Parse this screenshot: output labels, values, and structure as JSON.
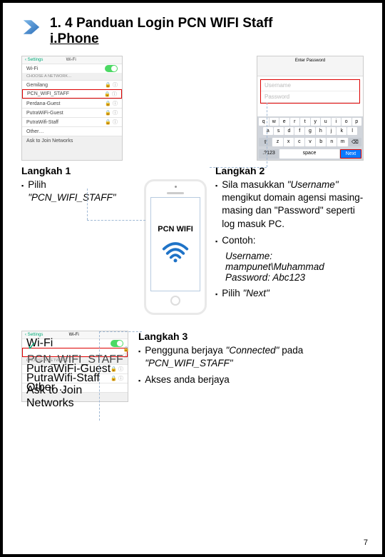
{
  "header": {
    "title_main": "1. 4  Panduan Login PCN WIFI Staff",
    "title_sub": "i.Phone"
  },
  "shot1": {
    "back": "Settings",
    "title": "Wi-Fi",
    "wifi_label": "Wi-Fi",
    "choose_hdr": "CHOOSE A NETWORK…",
    "nets": [
      "Gemilang",
      "PCN_WIFI_STAFF",
      "Perdana-Guest",
      "PutraWiFi-Guest",
      "PutraWifi-Staff",
      "Other…"
    ],
    "ask": "Ask to Join Networks"
  },
  "shot2": {
    "top": "Enter Password",
    "field1": "Username",
    "field2": "Password",
    "keys_r1": [
      "q",
      "w",
      "e",
      "r",
      "t",
      "y",
      "u",
      "i",
      "o",
      "p"
    ],
    "keys_r2": [
      "a",
      "s",
      "d",
      "f",
      "g",
      "h",
      "j",
      "k",
      "l"
    ],
    "keys_r3": [
      "z",
      "x",
      "c",
      "v",
      "b",
      "n",
      "m"
    ],
    "next": "Next"
  },
  "step1": {
    "title": "Langkah 1",
    "b1a": "Pilih ",
    "b1b": "\"PCN_WIFI_STAFF\""
  },
  "step2": {
    "title": "Langkah 2",
    "b1a": "Sila masukkan ",
    "b1b": "\"Username\"",
    "b1c": " mengikut domain agensi masing-masing dan \"Password\" seperti log masuk PC.",
    "b2": "Contoh:",
    "user_l": "Username:",
    "user_v": "mampunet\\Muhammad",
    "pass_l": "Password: ",
    "pass_v": "Abc123",
    "b3a": "Pilih ",
    "b3b": "\"Next\""
  },
  "phone_label": "PCN WIFI",
  "shot3": {
    "back": "Settings",
    "title": "Wi-Fi",
    "wifi_label": "Wi-Fi",
    "sel": "PCN_WIFI_STAFF",
    "choose_hdr": "CHOOSE A NETWORK…",
    "nets": [
      "PutraWiFi-Guest",
      "PutraWifi-Staff",
      "Other…"
    ],
    "ask": "Ask to Join Networks"
  },
  "step3": {
    "title": "Langkah 3",
    "b1a": "Pengguna berjaya ",
    "b1b": "\"Connected\"",
    "b1c": " pada ",
    "b1d": "\"PCN_WIFI_STAFF\"",
    "b2": "Akses anda berjaya"
  },
  "pagenum": "7"
}
